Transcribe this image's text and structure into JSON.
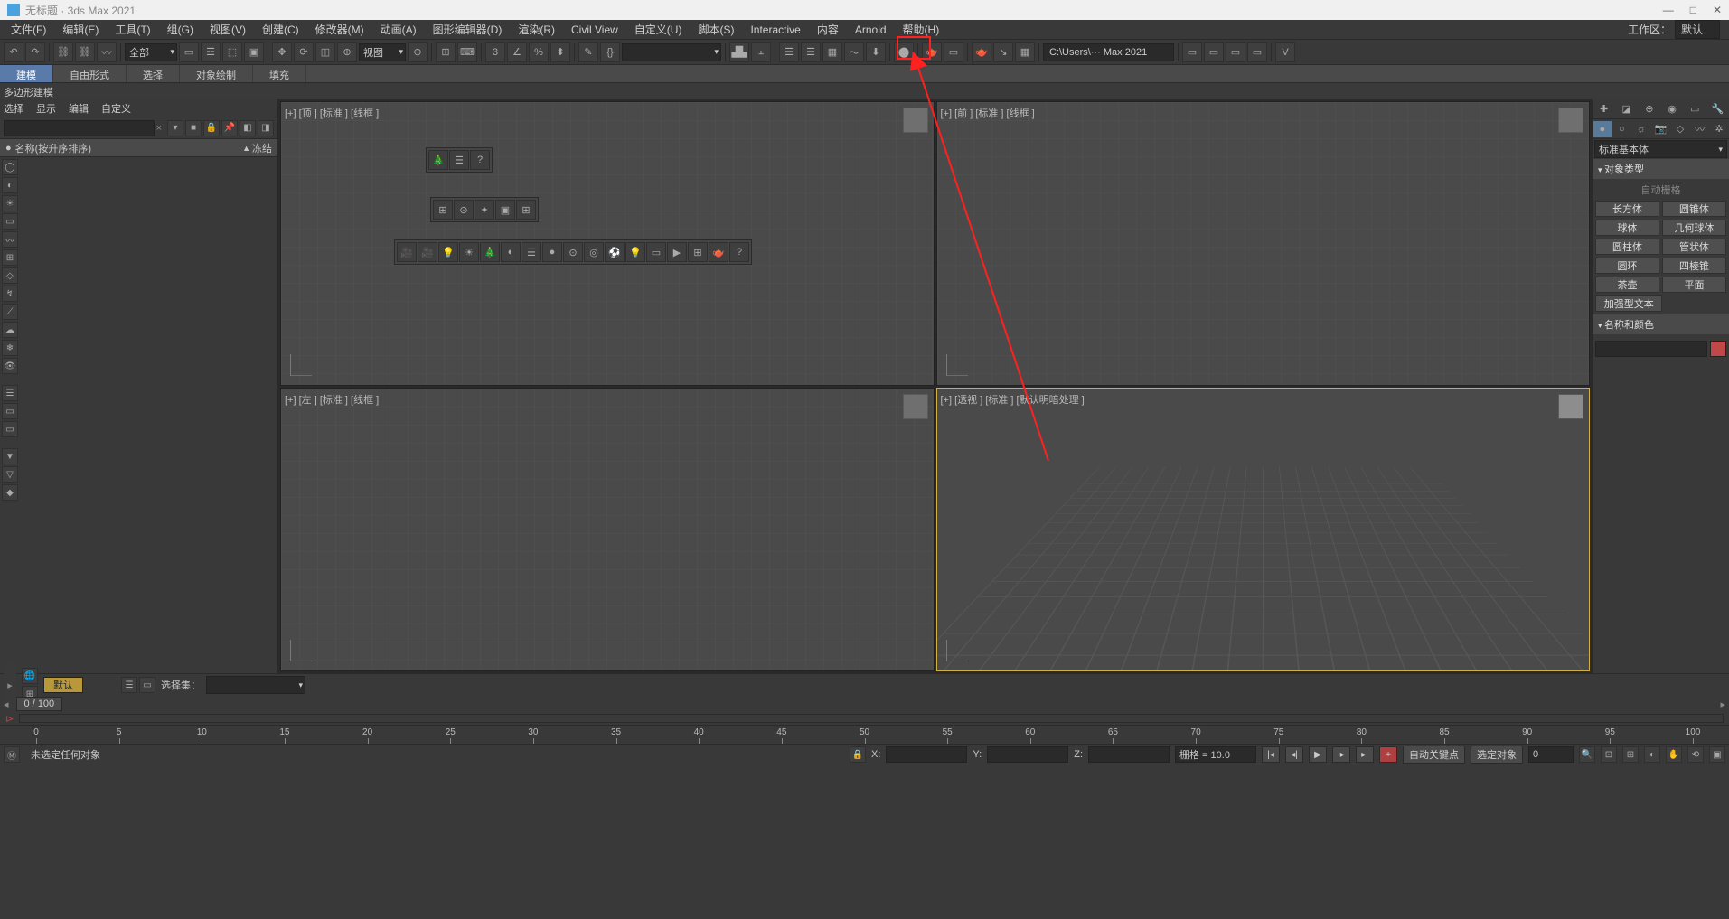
{
  "title": "无标题 · 3ds Max 2021",
  "menubar": {
    "items": [
      "文件(F)",
      "编辑(E)",
      "工具(T)",
      "组(G)",
      "视图(V)",
      "创建(C)",
      "修改器(M)",
      "动画(A)",
      "图形编辑器(D)",
      "渲染(R)",
      "Civil View",
      "自定义(U)",
      "脚本(S)",
      "Interactive",
      "内容",
      "Arnold",
      "帮助(H)"
    ],
    "workspace_label": "工作区：",
    "workspace_value": "默认"
  },
  "toolbar1": {
    "selection_filter": "全部",
    "ref_coord": "视图",
    "vray_path": "C:\\Users\\··· Max 2021"
  },
  "ribbon": {
    "tabs": [
      "建模",
      "自由形式",
      "选择",
      "对象绘制",
      "填充"
    ],
    "sub": "多边形建模"
  },
  "scene_explorer": {
    "tabs": [
      "选择",
      "显示",
      "编辑",
      "自定义"
    ],
    "col_name": "名称(按升序排序)",
    "col_freeze": "冻结"
  },
  "viewports": {
    "top": "[+] [顶 ] [标准 ] [线框 ]",
    "front": "[+] [前 ] [标准 ] [线框 ]",
    "left": "[+] [左 ] [标准 ] [线框 ]",
    "persp": "[+] [透视 ] [标准 ] [默认明暗处理 ]"
  },
  "command_panel": {
    "primitive_dropdown": "标准基本体",
    "rollout_objtype": "对象类型",
    "autogrid": "自动栅格",
    "buttons": [
      [
        "长方体",
        "圆锥体"
      ],
      [
        "球体",
        "几何球体"
      ],
      [
        "圆柱体",
        "管状体"
      ],
      [
        "圆环",
        "四棱锥"
      ],
      [
        "茶壶",
        "平面"
      ],
      [
        "加强型文本",
        ""
      ]
    ],
    "rollout_namecolor": "名称和颜色"
  },
  "track": {
    "default_label": "默认",
    "set_label": "选择集：",
    "frame_display": "0  /  100"
  },
  "timeline": {
    "ticks": [
      0,
      5,
      10,
      15,
      20,
      25,
      30,
      35,
      40,
      45,
      50,
      55,
      60,
      65,
      70,
      75,
      80,
      85,
      90,
      95,
      100
    ]
  },
  "status": {
    "no_selection": "未选定任何对象",
    "x": "X:",
    "y": "Y:",
    "z": "Z:",
    "grid": "栅格 = 10.0",
    "autokey": "自动关键点",
    "setkey": "选定对象",
    "spinner": "0"
  }
}
